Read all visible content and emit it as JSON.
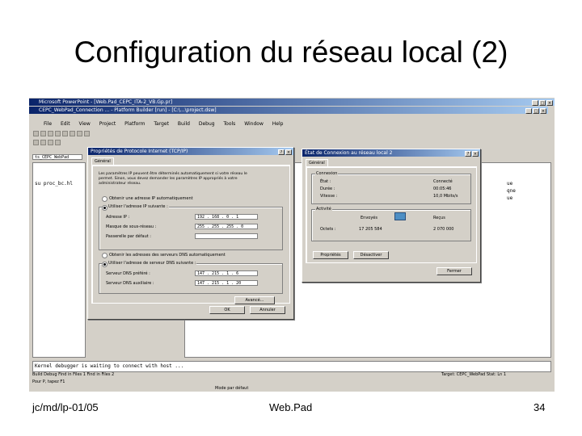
{
  "slide": {
    "title": "Configuration du réseau local (2)",
    "footer_left": "jc/md/lp-01/05",
    "footer_center": "Web.Pad",
    "footer_right": "34"
  },
  "screenshot": {
    "outer_window_title": "Microsoft PowerPoint - [Web.Pad_CEPC_ITA-2_VB.Gp.pr]",
    "inner_window_title": "CEPC_WebPad_Connection ... - Platform Builder [run] - [C:\\...\\project.dsw]",
    "menu": [
      "File",
      "Edit",
      "View",
      "Project",
      "Platform",
      "Target",
      "Build",
      "Debug",
      "Tools",
      "Window",
      "Help"
    ],
    "left_combo": "ts_CEPC_WebPad",
    "code_left": "su proc_bc.hl",
    "code_right": [
      "ue",
      "qne",
      "ue"
    ],
    "status_line_1": "Kernel debugger is waiting to connect with host ...",
    "status_tabs": "Build  Debug  Find in Files 1  Find in Files 2",
    "status_right": "Target: CEPC_WebPad  Stat: Ln 1",
    "status_bottom_left": "Pour P, tapez F1",
    "status_bottom_center": "Mode par défaut",
    "tcpip_dialog": {
      "title": "Propriétés de Protocole Internet (TCP/IP)",
      "tab": "Général",
      "intro": "Les paramètres IP peuvent être déterminés automatiquement si votre réseau le permet. Sinon, vous devez demander les paramètres IP appropriés à votre administrateur réseau.",
      "radio_auto_ip": "Obtenir une adresse IP automatiquement",
      "radio_manual_ip": "Utiliser l'adresse IP suivante :",
      "label_ip": "Adresse IP :",
      "value_ip": "192 . 168 . 0 . 1",
      "label_mask": "Masque de sous-réseau :",
      "value_mask": "255 . 255 . 255 . 0",
      "label_gateway": "Passerelle par défaut :",
      "value_gateway": "",
      "radio_auto_dns": "Obtenir les adresses des serveurs DNS automatiquement",
      "radio_manual_dns": "Utiliser l'adresse de serveur DNS suivante :",
      "label_dns1": "Serveur DNS préféré :",
      "value_dns1": "147 . 215 . 1 . 6",
      "label_dns2": "Serveur DNS auxiliaire :",
      "value_dns2": "147 . 215 . 1 . 20",
      "advanced_button": "Avancé...",
      "ok_button": "OK",
      "cancel_button": "Annuler"
    },
    "conn_dialog": {
      "title": "État de Connexion au réseau local 2",
      "tab": "Général",
      "group_connection": "Connexion",
      "label_state": "État :",
      "value_state": "Connecté",
      "label_duration": "Durée :",
      "value_duration": "00:05:46",
      "label_speed": "Vitesse :",
      "value_speed": "10,0 Mbits/s",
      "group_activity": "Activité",
      "label_sent": "Envoyés",
      "label_received": "Reçus",
      "label_octets": "Octets :",
      "value_sent": "17 205 584",
      "value_received": "2 070 000",
      "properties_button": "Propriétés",
      "disable_button": "Désactiver",
      "close_button": "Fermer"
    }
  }
}
